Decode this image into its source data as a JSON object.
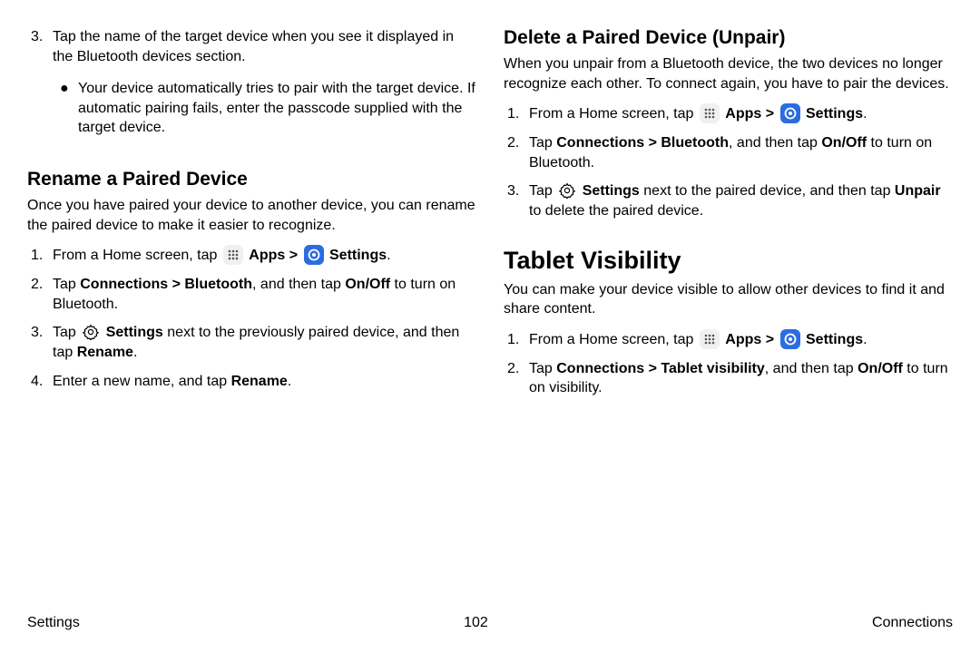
{
  "left": {
    "step3": {
      "num": "3.",
      "text": "Tap the name of the target device when you see it displayed in the Bluetooth devices section.",
      "bullet_mark": "●",
      "bullet": "Your device automatically tries to pair with the target device. If automatic pairing fails, enter the passcode supplied with the target device."
    },
    "rename": {
      "heading": "Rename a Paired Device",
      "intro": "Once you have paired your device to another device, you can rename the paired device to make it easier to recognize.",
      "s1": {
        "num": "1.",
        "pre": "From a Home screen, tap ",
        "apps": "Apps",
        "gt1": " > ",
        "settings": "Settings",
        "post": "."
      },
      "s2": {
        "num": "2.",
        "pre": "Tap ",
        "b1": "Connections > Bluetooth",
        "mid": ", and then tap ",
        "b2": "On/Off",
        "post": " to turn on Bluetooth."
      },
      "s3": {
        "num": "3.",
        "pre": "Tap ",
        "b1": "Settings",
        "mid": " next to the previously paired device, and then tap ",
        "b2": "Rename",
        "post": "."
      },
      "s4": {
        "num": "4.",
        "pre": "Enter a new name, and tap ",
        "b1": "Rename",
        "post": "."
      }
    }
  },
  "right": {
    "delete": {
      "heading": "Delete a Paired Device (Unpair)",
      "intro": "When you unpair from a Bluetooth device, the two devices no longer recognize each other. To connect again, you have to pair the devices.",
      "s1": {
        "num": "1.",
        "pre": "From a Home screen, tap ",
        "apps": "Apps",
        "gt1": " > ",
        "settings": "Settings",
        "post": "."
      },
      "s2": {
        "num": "2.",
        "pre": "Tap ",
        "b1": "Connections > Bluetooth",
        "mid": ", and then tap ",
        "b2": "On/Off",
        "post": " to turn on Bluetooth."
      },
      "s3": {
        "num": "3.",
        "pre": "Tap ",
        "b1": "Settings",
        "mid": " next to the paired device, and then tap ",
        "b2": "Unpair",
        "post": " to delete the paired device."
      }
    },
    "visibility": {
      "heading": "Tablet Visibility",
      "intro": "You can make your device visible to allow other devices to find it and share content.",
      "s1": {
        "num": "1.",
        "pre": "From a Home screen, tap ",
        "apps": "Apps",
        "gt1": " > ",
        "settings": "Settings",
        "post": "."
      },
      "s2": {
        "num": "2.",
        "pre": "Tap ",
        "b1": "Connections > Tablet visibility",
        "mid": ", and then tap ",
        "b2": "On/Off",
        "post": " to turn on visibility."
      }
    }
  },
  "footer": {
    "left": "Settings",
    "center": "102",
    "right": "Connections"
  }
}
